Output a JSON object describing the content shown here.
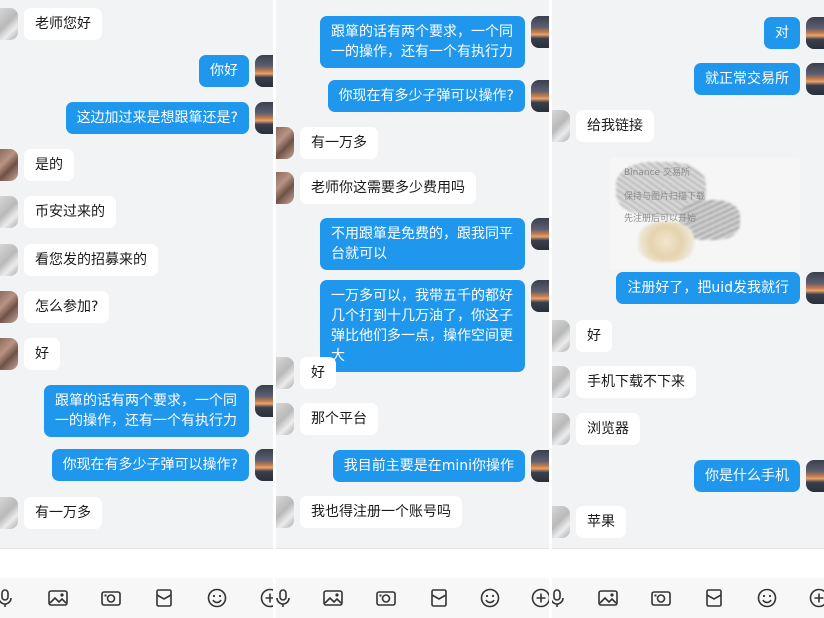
{
  "panels": [
    {
      "messages": [
        {
          "side": "left",
          "avatar": "gray",
          "text": "老师您好"
        },
        {
          "side": "right",
          "avatar": "sunset",
          "text": "你好"
        },
        {
          "side": "right",
          "avatar": "sunset",
          "text": "这边加过来是想跟箪还是?"
        },
        {
          "side": "left",
          "avatar": "brown",
          "text": "是的"
        },
        {
          "side": "left",
          "avatar": "gray",
          "text": "币安过来的"
        },
        {
          "side": "left",
          "avatar": "gray",
          "text": "看您发的招募来的"
        },
        {
          "side": "left",
          "avatar": "brown",
          "text": "怎么参加?"
        },
        {
          "side": "left",
          "avatar": "brown",
          "text": "好"
        },
        {
          "side": "right",
          "avatar": "sunset",
          "text": "跟箪的话有两个要求，一个同一的操作，还有一个有执行力"
        },
        {
          "side": "right",
          "avatar": "sunset",
          "text": "你现在有多少子弹可以操作?"
        },
        {
          "side": "left",
          "avatar": "gray",
          "text": "有一万多"
        }
      ]
    },
    {
      "messages": [
        {
          "side": "right",
          "avatar": "sunset",
          "text": "跟箪的话有两个要求，一个同一的操作，还有一个有执行力"
        },
        {
          "side": "right",
          "avatar": "sunset",
          "text": "你现在有多少子弹可以操作?"
        },
        {
          "side": "left",
          "avatar": "brown",
          "text": "有一万多"
        },
        {
          "side": "left",
          "avatar": "brown",
          "text": "老师你这需要多少费用吗"
        },
        {
          "side": "right",
          "avatar": "sunset",
          "text": "不用跟箪是免费的，跟我同平台就可以"
        },
        {
          "side": "right",
          "avatar": "sunset",
          "text": "一万多可以，我带五千的都好几个打到十几万油了，你这子弹比他们多一点，操作空间更大"
        },
        {
          "side": "left",
          "avatar": "gray",
          "text": "好"
        },
        {
          "side": "left",
          "avatar": "gray",
          "text": "那个平台"
        },
        {
          "side": "right",
          "avatar": "sunset",
          "text": "我目前主要是在mini你操作"
        },
        {
          "side": "left",
          "avatar": "gray",
          "text": "我也得注册一个账号吗"
        }
      ]
    },
    {
      "messages": [
        {
          "side": "right",
          "avatar": "sunset",
          "text": "对"
        },
        {
          "side": "right",
          "avatar": "sunset",
          "text": "就正常交易所"
        },
        {
          "side": "left",
          "avatar": "gray",
          "text": "给我链接"
        },
        {
          "side": "right",
          "avatar": "sunset",
          "text": "注册好了，把uid发我就行"
        },
        {
          "side": "left",
          "avatar": "gray",
          "text": "好"
        },
        {
          "side": "left",
          "avatar": "gray",
          "text": "手机下载不下来"
        },
        {
          "side": "left",
          "avatar": "gray",
          "text": "浏览器"
        },
        {
          "side": "right",
          "avatar": "sunset",
          "text": "你是什么手机"
        },
        {
          "side": "left",
          "avatar": "gray",
          "text": "苹果"
        }
      ],
      "shared_image": {
        "lines": [
          "Binance 交易所",
          "保持与图片扫描下载",
          "先注册后可以开始"
        ]
      }
    }
  ],
  "toolbar_icons": [
    "microphone-icon",
    "image-icon",
    "camera-icon",
    "red-packet-icon",
    "emoji-icon",
    "plus-icon"
  ]
}
